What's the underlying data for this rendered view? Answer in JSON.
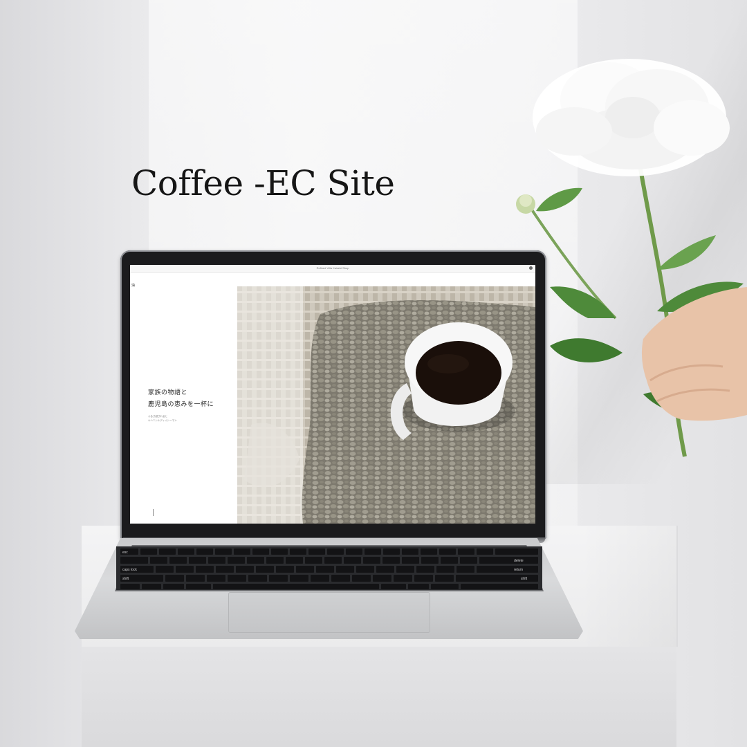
{
  "headline": "Coffee -EC Site",
  "browser": {
    "url": "Refined Villa Kaiseki Shop"
  },
  "site": {
    "logo": "油",
    "hero_line1": "家族の物語と",
    "hero_line2": "鹿児島の恵みを一杯に",
    "hero_sub1": "ふるさ越されると",
    "hero_sub2": "ケハニシルディイシーマン"
  },
  "keyboard": {
    "keys": {
      "delete": "delete",
      "return": "return",
      "shift": "shift",
      "caps": "caps lock",
      "esc": "esc"
    }
  },
  "colors": {
    "background": "#ececee",
    "headline": "#161616",
    "lid": "#1b1b1d",
    "coffee": "#1a0f0a",
    "beans": "#8d8a7e",
    "leaf": "#4e8a3a"
  },
  "icons": {
    "profile": "profile-dot-icon",
    "scroll": "scroll-line-icon"
  }
}
